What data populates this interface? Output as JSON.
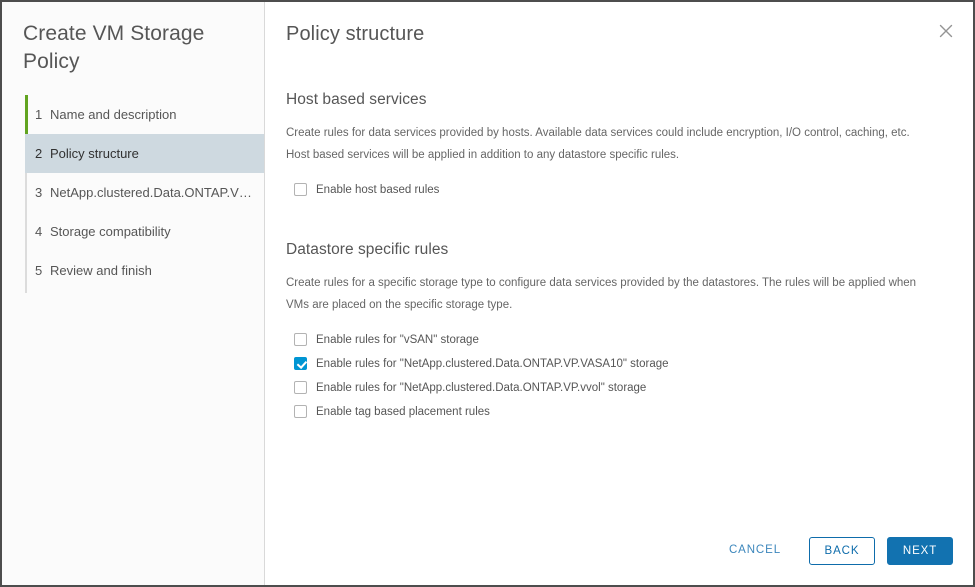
{
  "wizard": {
    "title": "Create VM Storage Policy",
    "steps": [
      {
        "num": "1",
        "label": "Name and description"
      },
      {
        "num": "2",
        "label": "Policy structure"
      },
      {
        "num": "3",
        "label": "NetApp.clustered.Data.ONTAP.VP...."
      },
      {
        "num": "4",
        "label": "Storage compatibility"
      },
      {
        "num": "5",
        "label": "Review and finish"
      }
    ],
    "active_step_index": 1,
    "completed_step_index": 0
  },
  "page": {
    "title": "Policy structure",
    "close_icon": "close-icon"
  },
  "host_based_services": {
    "heading": "Host based services",
    "desc_line1": "Create rules for data services provided by hosts. Available data services could include encryption, I/O control, caching, etc.",
    "desc_line2": "Host based services will be applied in addition to any datastore specific rules.",
    "checkbox": {
      "label": "Enable host based rules",
      "checked": false
    }
  },
  "datastore_specific_rules": {
    "heading": "Datastore specific rules",
    "desc_line1": "Create rules for a specific storage type to configure data services provided by the datastores. The rules will be applied when",
    "desc_line2": "VMs are placed on the specific storage type.",
    "checkboxes": [
      {
        "label": "Enable rules for \"vSAN\" storage",
        "checked": false
      },
      {
        "label": "Enable rules for \"NetApp.clustered.Data.ONTAP.VP.VASA10\" storage",
        "checked": true
      },
      {
        "label": "Enable rules for \"NetApp.clustered.Data.ONTAP.VP.vvol\" storage",
        "checked": false
      },
      {
        "label": "Enable tag based placement rules",
        "checked": false
      }
    ]
  },
  "footer": {
    "cancel_label": "CANCEL",
    "back_label": "BACK",
    "next_label": "NEXT"
  },
  "colors": {
    "accent_green": "#62a420",
    "active_step_bg": "#ced9e0",
    "primary_button": "#1272b0",
    "link_blue": "#3d87bc",
    "checkbox_checked": "#0095d3"
  }
}
